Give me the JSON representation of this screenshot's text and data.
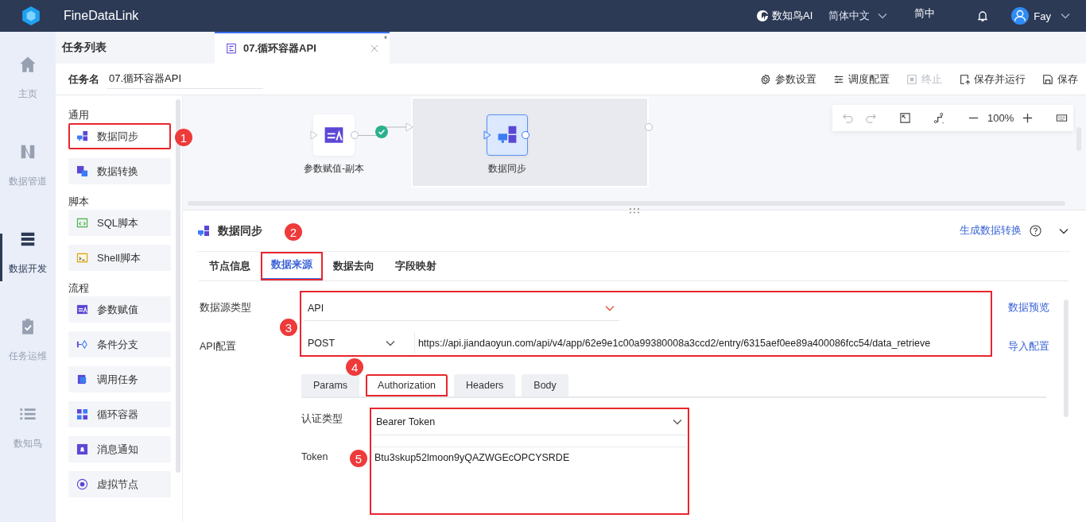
{
  "app": {
    "name": "FineDataLink"
  },
  "header": {
    "ai": "数知鸟AI",
    "language": "简体中文",
    "lang_short": "简中",
    "user": "Fay"
  },
  "nav": [
    {
      "label": "主页",
      "selected": false
    },
    {
      "label": "数据管道",
      "selected": false
    },
    {
      "label": "数据开发",
      "selected": true
    },
    {
      "label": "任务运维",
      "selected": false
    },
    {
      "label": "数知鸟",
      "selected": false
    }
  ],
  "task_list_title": "任务列表",
  "tab": {
    "title": "07.循环容器API",
    "modified_mark": "*"
  },
  "task_name": {
    "label": "任务名",
    "value": "07.循环容器API"
  },
  "actions": [
    {
      "label": "参数设置",
      "disabled": false
    },
    {
      "label": "调度配置",
      "disabled": false
    },
    {
      "label": "终止",
      "disabled": true
    },
    {
      "label": "保存并运行",
      "disabled": false
    },
    {
      "label": "保存",
      "disabled": false
    }
  ],
  "palette": [
    {
      "group": "通用",
      "items": [
        {
          "label": "数据同步",
          "highlighted": true,
          "callout": "1"
        },
        {
          "label": "数据转换",
          "highlighted": false
        }
      ]
    },
    {
      "group": "脚本",
      "items": [
        {
          "label": "SQL脚本",
          "highlighted": false
        },
        {
          "label": "Shell脚本",
          "highlighted": false
        }
      ]
    },
    {
      "group": "流程",
      "items": [
        {
          "label": "参数赋值",
          "highlighted": false
        },
        {
          "label": "条件分支",
          "highlighted": false
        },
        {
          "label": "调用任务",
          "highlighted": false
        },
        {
          "label": "循环容器",
          "highlighted": false
        },
        {
          "label": "消息通知",
          "highlighted": false
        },
        {
          "label": "虚拟节点",
          "highlighted": false
        }
      ]
    }
  ],
  "canvas": {
    "zoom": "100%",
    "nodes": [
      {
        "label": "参数赋值-副本",
        "selected": false
      },
      {
        "label": "数据同步",
        "selected": true
      }
    ]
  },
  "panel": {
    "title": "数据同步",
    "generate_link": "生成数据转换",
    "tabs": [
      {
        "label": "节点信息",
        "selected": false,
        "highlighted": false
      },
      {
        "label": "数据来源",
        "selected": true,
        "highlighted": true,
        "callout": "2"
      },
      {
        "label": "数据去向",
        "selected": false,
        "highlighted": false
      },
      {
        "label": "字段映射",
        "selected": false,
        "highlighted": false
      }
    ],
    "source": {
      "highlighted": true,
      "callout": "3",
      "type_label": "数据源类型",
      "type_value": "API",
      "config_label": "API配置",
      "method": "POST",
      "url": "https://api.jiandaoyun.com/api/v4/app/62e9e1c00a99380008a3ccd2/entry/6315aef0ee89a400086fcc54/data_retrieve",
      "preview_link": "数据预览",
      "import_link": "导入配置"
    },
    "subtabs": [
      {
        "label": "Params",
        "selected": false,
        "highlighted": false
      },
      {
        "label": "Authorization",
        "selected": true,
        "highlighted": true,
        "callout": "4"
      },
      {
        "label": "Headers",
        "selected": false,
        "highlighted": false
      },
      {
        "label": "Body",
        "selected": false,
        "highlighted": false
      }
    ],
    "auth": {
      "highlighted": true,
      "callout": "5",
      "type_label": "认证类型",
      "type_value": "Bearer Token",
      "token_label": "Token",
      "token_value": "Btu3skup52lmoon9yQAZWGEcOPCYSRDE"
    }
  }
}
